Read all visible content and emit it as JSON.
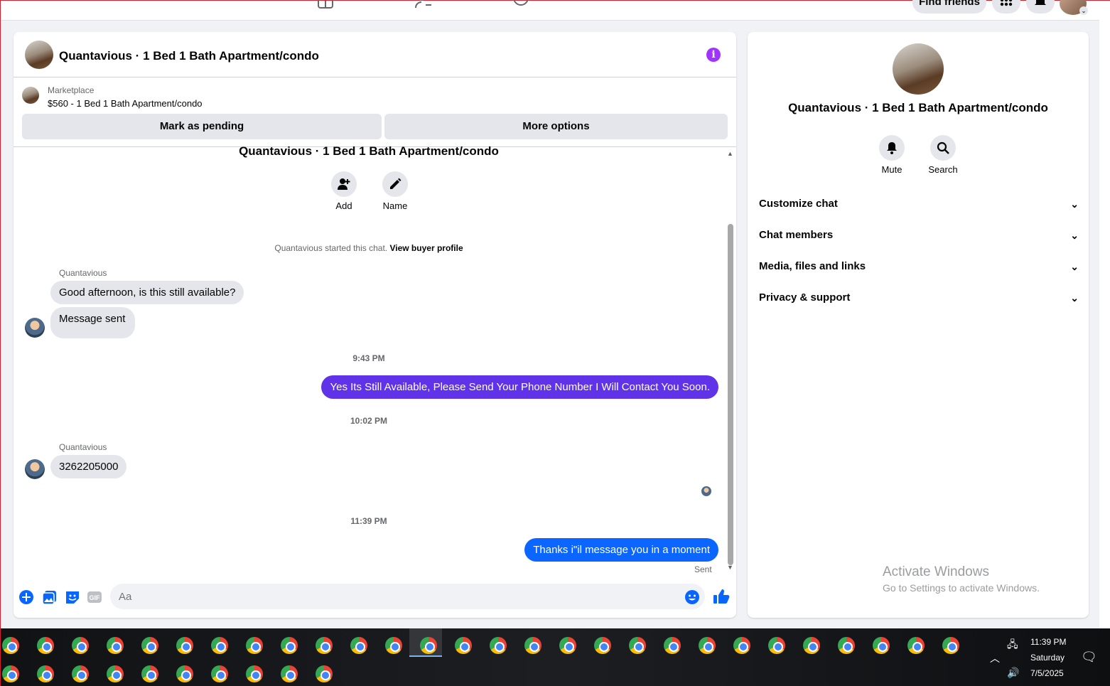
{
  "topnav": {
    "find_friends": "Find friends"
  },
  "chat": {
    "header_title": "Quantavious · 1 Bed 1 Bath Apartment/condo",
    "marketplace_label": "Marketplace",
    "listing": "$560 - 1 Bed 1 Bath Apartment/condo",
    "mark_pending": "Mark as pending",
    "more_options": "More options",
    "conversation_title": "Quantavious · 1 Bed 1 Bath Apartment/condo",
    "add_label": "Add",
    "name_label": "Name",
    "started_text": "Quantavious started this chat.",
    "view_buyer": "View buyer profile",
    "messages": [
      {
        "sender": "Quantavious",
        "text": "Good afternoon, is this still available?"
      },
      {
        "text": "Message sent"
      },
      {
        "time": "9:43 PM"
      },
      {
        "text": "Yes Its Still Available, Please Send Your Phone Number I Will Contact You Soon.",
        "color": "#6033e8"
      },
      {
        "time": "10:02 PM"
      },
      {
        "sender": "Quantavious",
        "text": "3262205000"
      },
      {
        "time": "11:39 PM"
      },
      {
        "text": "Thanks i\"il message you in a moment",
        "color": "#0a66ff"
      }
    ],
    "sent_label": "Sent",
    "input_placeholder": "Aa"
  },
  "info_panel": {
    "title": "Quantavious · 1 Bed 1 Bath Apartment/condo",
    "mute_label": "Mute",
    "search_label": "Search",
    "rows": [
      "Customize chat",
      "Chat members",
      "Media, files and links",
      "Privacy & support"
    ]
  },
  "watermark": {
    "line1": "Activate Windows",
    "line2": "Go to Settings to activate Windows."
  },
  "taskbar": {
    "time": "11:39 PM",
    "day": "Saturday",
    "date": "7/5/2025"
  },
  "colors": {
    "accent": "#0866ff",
    "purple_bubble": "#6033e8",
    "info": "#a033ff"
  },
  "icons": [
    "marketplace-icon",
    "friends-icon",
    "groups-icon",
    "menu-grid-icon",
    "bell-icon",
    "info-icon",
    "add-person-icon",
    "pencil-icon",
    "plus-icon",
    "photo-icon",
    "sticker-icon",
    "gif-icon",
    "emoji-icon",
    "thumbs-up-icon",
    "search-icon",
    "chevron-down-icon",
    "chrome-icon"
  ]
}
